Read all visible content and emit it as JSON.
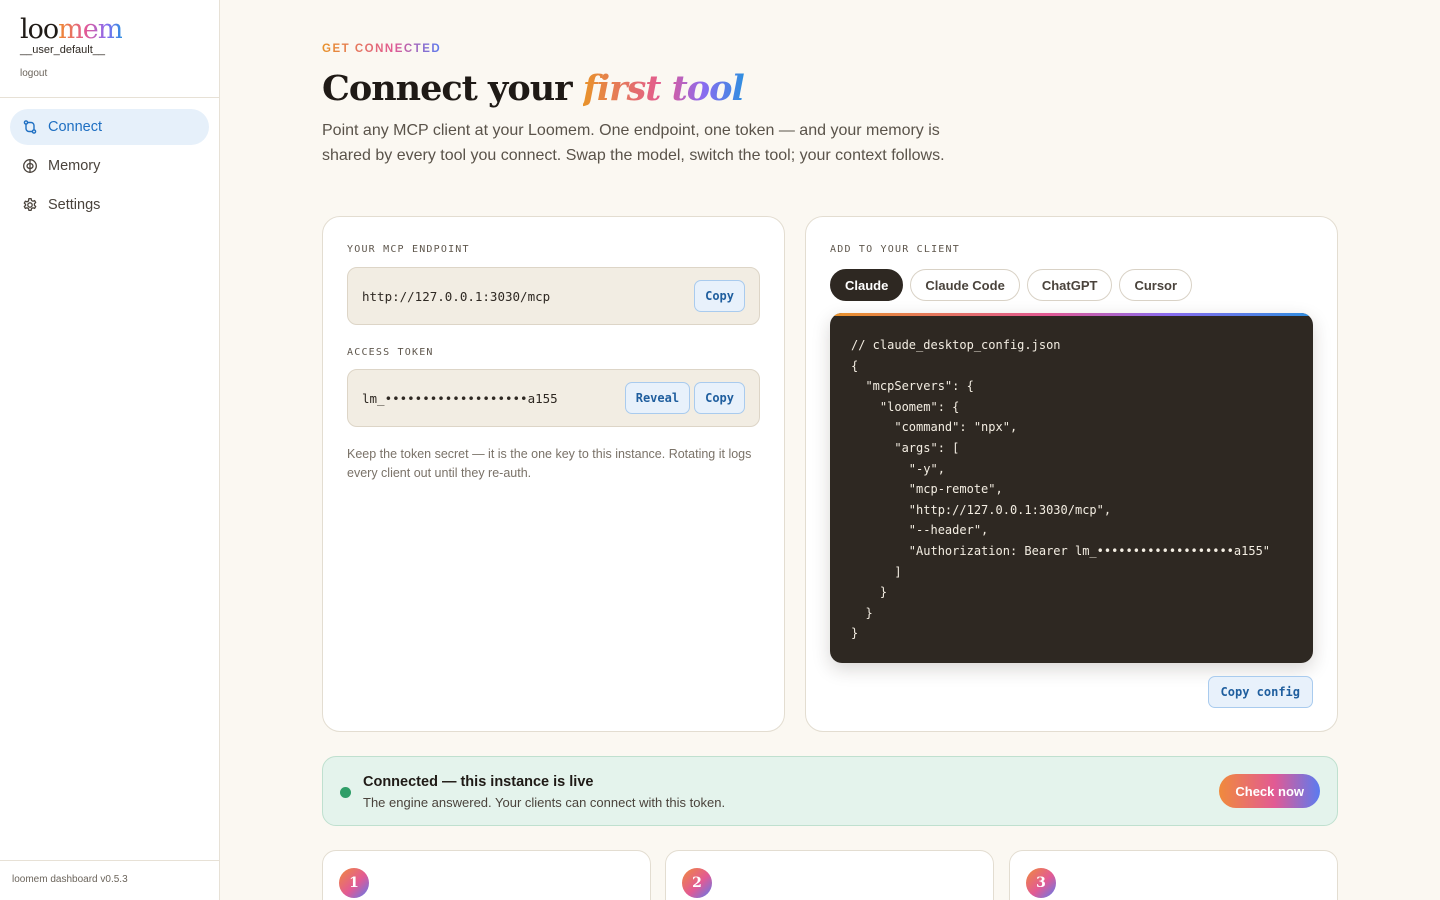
{
  "sidebar": {
    "brand": {
      "prefix": "loo",
      "accent": "mem"
    },
    "user": "__user_default__",
    "logout": "logout",
    "items": [
      {
        "label": "Connect",
        "icon": "plug-icon"
      },
      {
        "label": "Memory",
        "icon": "brain-icon"
      },
      {
        "label": "Settings",
        "icon": "gear-icon"
      }
    ],
    "version": "loomem dashboard v0.5.3"
  },
  "header": {
    "eyebrow": "GET CONNECTED",
    "title_prefix": "Connect your ",
    "title_accent": "first tool",
    "lede": "Point any MCP client at your Loomem. One endpoint, one token — and your memory is shared by every tool you connect. Swap the model, switch the tool; your context follows."
  },
  "endpoint": {
    "label": "YOUR MCP ENDPOINT",
    "value": "http://127.0.0.1:3030/mcp",
    "copy_label": "Copy"
  },
  "token": {
    "label": "ACCESS TOKEN",
    "value": "lm_•••••••••••••••••••a155",
    "reveal_label": "Reveal",
    "copy_label": "Copy",
    "note": "Keep the token secret — it is the one key to this instance. Rotating it logs every client out until they re-auth."
  },
  "client": {
    "label": "ADD TO YOUR CLIENT",
    "tabs": [
      "Claude",
      "Claude Code",
      "ChatGPT",
      "Cursor"
    ],
    "active_tab": "Claude",
    "code": "// claude_desktop_config.json\n{\n  \"mcpServers\": {\n    \"loomem\": {\n      \"command\": \"npx\",\n      \"args\": [\n        \"-y\",\n        \"mcp-remote\",\n        \"http://127.0.0.1:3030/mcp\",\n        \"--header\",\n        \"Authorization: Bearer lm_•••••••••••••••••••a155\"\n      ]\n    }\n  }\n}",
    "copy_config_label": "Copy config"
  },
  "status": {
    "title": "Connected — this instance is live",
    "subtitle": "The engine answered. Your clients can connect with this token.",
    "button": "Check now",
    "color": "#2f9e68"
  },
  "steps": [
    "1",
    "2",
    "3"
  ]
}
